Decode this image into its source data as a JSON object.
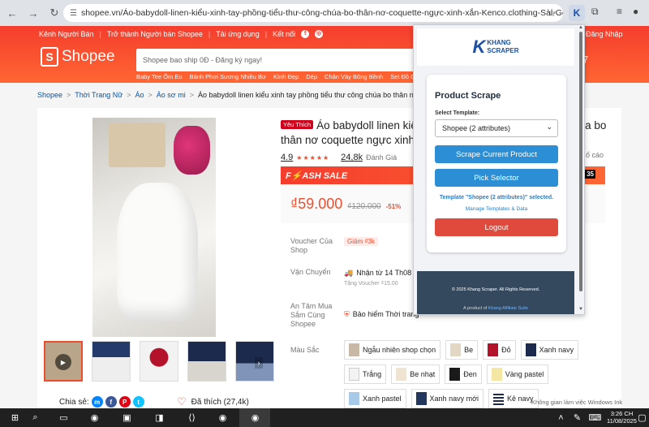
{
  "browser": {
    "url": "shopee.vn/Áo-babydoll-linen-kiểu-xinh-tay-phồng-tiểu-thư-công-chúa-bo-thân-nơ-coquette-ngực-xinh-xắn-Kenco.clothing-Sài-Gòn-M329-i.186979045..."
  },
  "shopee": {
    "toplinks": [
      "Kênh Người Bán",
      "Trở thành Người bán Shopee",
      "Tải ứng dụng",
      "Kết nối"
    ],
    "login": "Đăng Nhập",
    "logo": "Shopee",
    "search_placeholder": "Shopee bao ship 0Đ - Đăng ký ngay!",
    "hotwords": [
      "Baby Tee Ôm Eo",
      "Bánh Phơi Sương Nhiều Bơ",
      "Kính Đẹp",
      "Dép",
      "Chăn Váy Bông Bềnh",
      "Set Đồ Quần Cố"
    ]
  },
  "breadcrumb": [
    "Shopee",
    "Thời Trang Nữ",
    "Áo",
    "Áo sơ mi",
    "Áo babydoll linen kiểu xinh tay phồng tiểu thư công chúa bo thân nơ coquette ngực xinh xắn Kenco"
  ],
  "product": {
    "badge": "Yêu Thích",
    "title": "Áo babydoll linen kiểu xinh tay phồng tiểu thư công chúa bo thân nơ coquette ngực xinh xắn Kenco",
    "rating": "4.9",
    "rating_count": "24,8k",
    "rating_label": "Đánh Giá",
    "report": "ố cáo",
    "flash_sale": "F⚡ASH SALE",
    "timer": "35",
    "price": "₫59.000",
    "old_price": "₫120.000",
    "discount": "-51%",
    "voucher_label": "Voucher Của Shop",
    "voucher_value": "Giảm ₫3k",
    "ship_label": "Vận Chuyển",
    "ship_value": "Nhận từ 14 Th08 -",
    "ship_sub": "Tặng Voucher ₫15.00",
    "safe_label": "An Tâm Mua Sắm Cùng Shopee",
    "safe_value": "Bảo hiểm Thời trang",
    "color_label": "Màu Sắc",
    "variants": [
      "Ngẫu nhiên shop chọn",
      "Be",
      "Đỏ",
      "Xanh navy",
      "Trắng",
      "Be nhạt",
      "Đen",
      "Vàng pastel",
      "Xanh pastel",
      "Xanh navy mới",
      "Kẻ navy"
    ],
    "share_label": "Chia sẻ:",
    "like_label": "Đã thích (27,4k)"
  },
  "popup": {
    "logo_line1": "KHANG",
    "logo_line2": "SCRAPER",
    "title": "Product Scrape",
    "template_label": "Select Template:",
    "template_value": "Shopee (2 attributes)",
    "btn_scrape": "Scrape Current Product",
    "btn_pick": "Pick Selector",
    "status": "Template \"Shopee (2 attributes)\" selected.",
    "manage": "Manage Templates & Data",
    "btn_logout": "Logout",
    "footer": "© 2025 Khang Scraper. All Rights Reserved.",
    "product_of": "A product of",
    "affiliate": "Khang Affiliate Suite"
  },
  "system": {
    "watermark": "Không gian làm việc Windows Ink",
    "time": "3:26 CH",
    "date": "11/08/2025"
  },
  "colors": {
    "shopee_orange": "#f53d2d",
    "popup_blue": "#2c8fd6",
    "popup_red": "#e04a3c"
  }
}
